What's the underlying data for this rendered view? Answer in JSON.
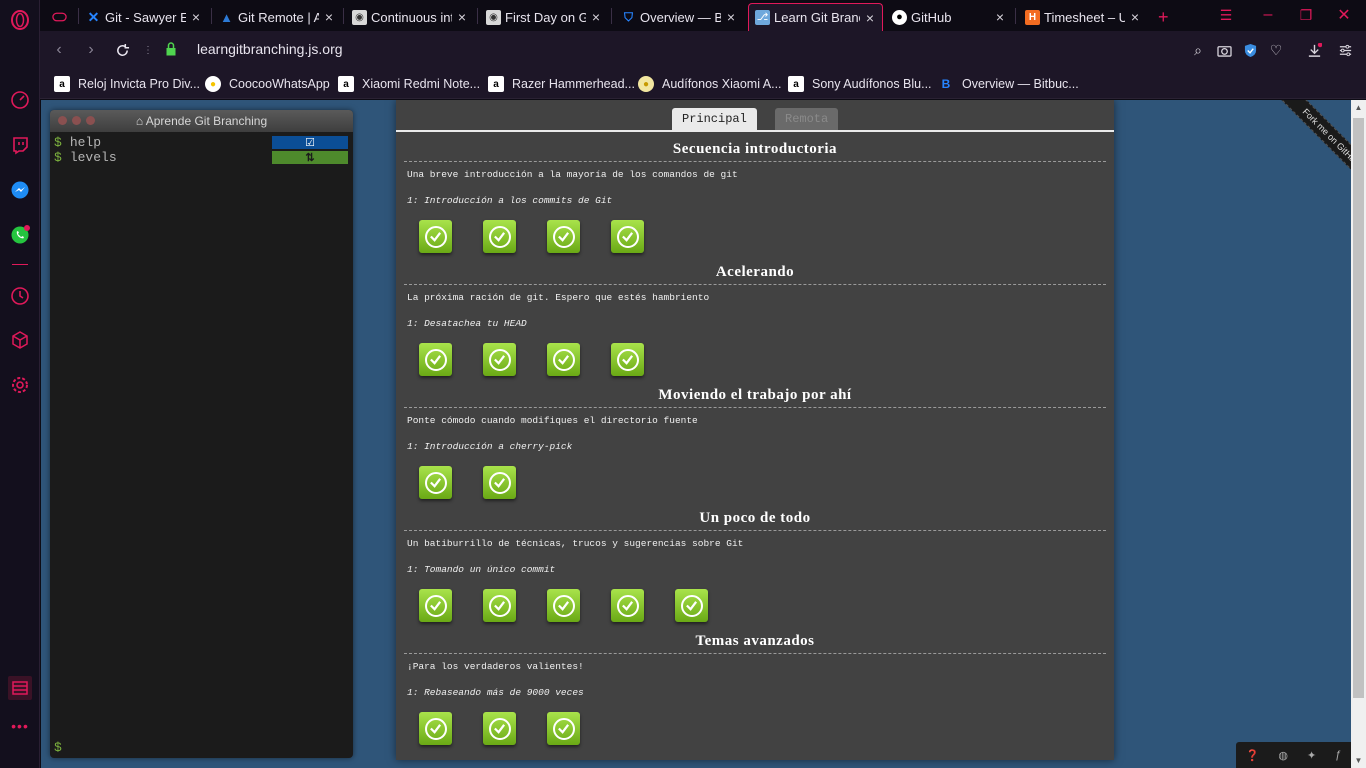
{
  "tabs": [
    {
      "label": "",
      "fav": "gamepad-icon",
      "close": ""
    },
    {
      "label": "Git - Sawyer Effi",
      "fav": "jira-icon",
      "close": "×"
    },
    {
      "label": "Git Remote | Az",
      "fav": "azure-icon",
      "close": "×"
    },
    {
      "label": "Continuous inte",
      "fav": "github-cat-icon",
      "close": "×"
    },
    {
      "label": "First Day on Gi",
      "fav": "github-cat-icon",
      "close": "×"
    },
    {
      "label": "Overview — Bit",
      "fav": "bitbucket-icon",
      "close": "×"
    },
    {
      "label": "Learn Git Branc",
      "fav": "learngit-icon",
      "close": "×"
    },
    {
      "label": "GitHub",
      "fav": "github-icon",
      "close": "×"
    },
    {
      "label": "Timesheet – Un",
      "fav": "harvest-icon",
      "close": "×"
    }
  ],
  "new_tab": "+",
  "address": {
    "url": "learngitbranching.js.org"
  },
  "bookmarks": [
    {
      "label": "Reloj Invicta Pro Div...",
      "fav": "a"
    },
    {
      "label": "CoocooWhatsApp",
      "fav": "●"
    },
    {
      "label": "Xiaomi Redmi Note...",
      "fav": "a"
    },
    {
      "label": "Razer Hammerhead...",
      "fav": "a"
    },
    {
      "label": "Audífonos Xiaomi A...",
      "fav": "●"
    },
    {
      "label": "Sony Audífonos Blu...",
      "fav": "a"
    },
    {
      "label": "Overview — Bitbuc...",
      "fav": "B"
    }
  ],
  "terminal": {
    "title": "Aprende Git Branching",
    "lines": [
      {
        "prompt": "$",
        "cmd": "help"
      },
      {
        "prompt": "$",
        "cmd": "levels"
      }
    ],
    "badge_help": "☑",
    "badge_levels": "⇅",
    "input_prompt": "$"
  },
  "panel": {
    "tab_main": "Principal",
    "tab_remote": "Remota",
    "sections": [
      {
        "title": "Secuencia introductoria",
        "desc": "Una breve introducción a la mayoría de los comandos de git",
        "sub": "1: Introducción a los commits de Git",
        "levels": 4
      },
      {
        "title": "Acelerando",
        "desc": "La próxima ración de git. Espero que estés hambriento",
        "sub": "1: Desatachea tu HEAD",
        "levels": 4
      },
      {
        "title": "Moviendo el trabajo por ahí",
        "desc": "Ponte cómodo cuando modifiques el directorio fuente",
        "sub": "1: Introducción a cherry-pick",
        "levels": 2
      },
      {
        "title": "Un poco de todo",
        "desc": "Un batiburrillo de técnicas, trucos y sugerencias sobre Git",
        "sub": "1: Tomando un único commit",
        "levels": 5
      },
      {
        "title": "Temas avanzados",
        "desc": "¡Para los verdaderos valientes!",
        "sub": "1: Rebaseando más de 9000 veces",
        "levels": 3
      }
    ]
  },
  "ribbon": "Fork me on GitHub",
  "colors": {
    "accent": "#e0195a",
    "page_bg": "#2f5579",
    "level_green": "#7dbb1f"
  }
}
